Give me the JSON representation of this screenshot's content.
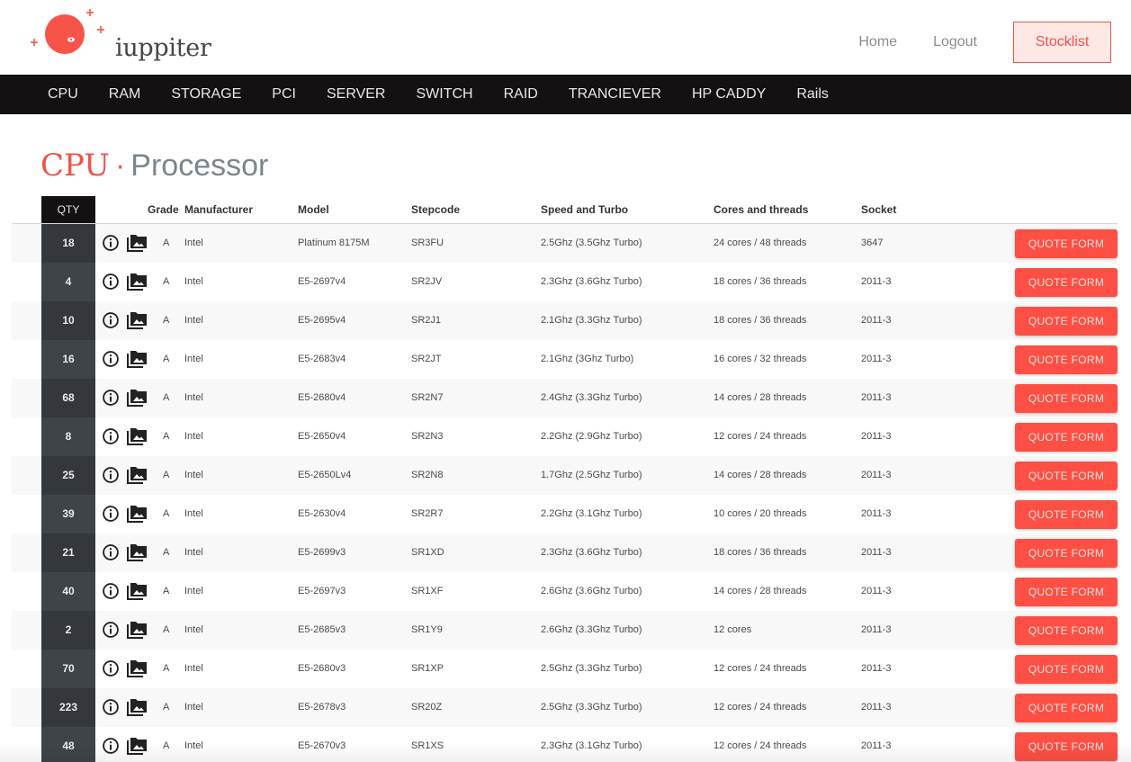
{
  "header": {
    "logo_text": "iuppiter",
    "nav": {
      "home": "Home",
      "logout": "Logout",
      "stocklist": "Stocklist"
    }
  },
  "categories": [
    "CPU",
    "RAM",
    "STORAGE",
    "PCI",
    "SERVER",
    "SWITCH",
    "RAID",
    "TRANCIEVER",
    "HP CADDY",
    "Rails"
  ],
  "page": {
    "category": "CPU",
    "separator": "·",
    "subtitle": "Processor"
  },
  "colors": {
    "accent": "#f0524a",
    "quote_button": "#fe4f44",
    "nav_bg": "#141113",
    "qty_bg_dark": "#34383c",
    "qty_bg_light": "#3f4448"
  },
  "table": {
    "columns": {
      "qty": "QTY",
      "grade": "Grade",
      "manufacturer": "Manufacturer",
      "model": "Model",
      "stepcode": "Stepcode",
      "speed": "Speed and Turbo",
      "cores": "Cores and threads",
      "socket": "Socket"
    },
    "quote_label": "QUOTE FORM",
    "rows": [
      {
        "qty": "18",
        "grade": "A",
        "manufacturer": "Intel",
        "model": "Platinum 8175M",
        "stepcode": "SR3FU",
        "speed": "2.5Ghz (3.5Ghz Turbo)",
        "cores": "24 cores / 48 threads",
        "socket": "3647"
      },
      {
        "qty": "4",
        "grade": "A",
        "manufacturer": "Intel",
        "model": "E5-2697v4",
        "stepcode": "SR2JV",
        "speed": "2.3Ghz (3.6Ghz Turbo)",
        "cores": "18 cores / 36 threads",
        "socket": "2011-3"
      },
      {
        "qty": "10",
        "grade": "A",
        "manufacturer": "Intel",
        "model": "E5-2695v4",
        "stepcode": "SR2J1",
        "speed": "2.1Ghz (3.3Ghz Turbo)",
        "cores": "18 cores / 36 threads",
        "socket": "2011-3"
      },
      {
        "qty": "16",
        "grade": "A",
        "manufacturer": "Intel",
        "model": "E5-2683v4",
        "stepcode": "SR2JT",
        "speed": "2.1Ghz (3Ghz Turbo)",
        "cores": "16 cores / 32 threads",
        "socket": "2011-3"
      },
      {
        "qty": "68",
        "grade": "A",
        "manufacturer": "Intel",
        "model": "E5-2680v4",
        "stepcode": "SR2N7",
        "speed": "2.4Ghz (3.3Ghz Turbo)",
        "cores": "14 cores / 28 threads",
        "socket": "2011-3"
      },
      {
        "qty": "8",
        "grade": "A",
        "manufacturer": "Intel",
        "model": "E5-2650v4",
        "stepcode": "SR2N3",
        "speed": "2.2Ghz (2.9Ghz Turbo)",
        "cores": "12 cores / 24 threads",
        "socket": "2011-3"
      },
      {
        "qty": "25",
        "grade": "A",
        "manufacturer": "Intel",
        "model": "E5-2650Lv4",
        "stepcode": "SR2N8",
        "speed": "1.7Ghz (2.5Ghz Turbo)",
        "cores": "14 cores / 28 threads",
        "socket": "2011-3"
      },
      {
        "qty": "39",
        "grade": "A",
        "manufacturer": "Intel",
        "model": "E5-2630v4",
        "stepcode": "SR2R7",
        "speed": "2.2Ghz (3.1Ghz Turbo)",
        "cores": "10 cores / 20 threads",
        "socket": "2011-3"
      },
      {
        "qty": "21",
        "grade": "A",
        "manufacturer": "Intel",
        "model": "E5-2699v3",
        "stepcode": "SR1XD",
        "speed": "2.3Ghz (3.6Ghz Turbo)",
        "cores": "18 cores / 36 threads",
        "socket": "2011-3"
      },
      {
        "qty": "40",
        "grade": "A",
        "manufacturer": "Intel",
        "model": "E5-2697v3",
        "stepcode": "SR1XF",
        "speed": "2.6Ghz (3.6Ghz Turbo)",
        "cores": "14 cores / 28 threads",
        "socket": "2011-3"
      },
      {
        "qty": "2",
        "grade": "A",
        "manufacturer": "Intel",
        "model": "E5-2685v3",
        "stepcode": "SR1Y9",
        "speed": "2.6Ghz (3.3Ghz Turbo)",
        "cores": "12 cores",
        "socket": "2011-3"
      },
      {
        "qty": "70",
        "grade": "A",
        "manufacturer": "Intel",
        "model": "E5-2680v3",
        "stepcode": "SR1XP",
        "speed": "2.5Ghz (3.3Ghz Turbo)",
        "cores": "12 cores / 24 threads",
        "socket": "2011-3"
      },
      {
        "qty": "223",
        "grade": "A",
        "manufacturer": "Intel",
        "model": "E5-2678v3",
        "stepcode": "SR20Z",
        "speed": "2.5Ghz (3.3Ghz Turbo)",
        "cores": "12 cores / 24 threads",
        "socket": "2011-3"
      },
      {
        "qty": "48",
        "grade": "A",
        "manufacturer": "Intel",
        "model": "E5-2670v3",
        "stepcode": "SR1XS",
        "speed": "2.3Ghz (3.1Ghz Turbo)",
        "cores": "12 cores / 24 threads",
        "socket": "2011-3"
      }
    ]
  },
  "icons": {
    "info": "info-circle-icon",
    "gallery": "photo-library-icon"
  }
}
